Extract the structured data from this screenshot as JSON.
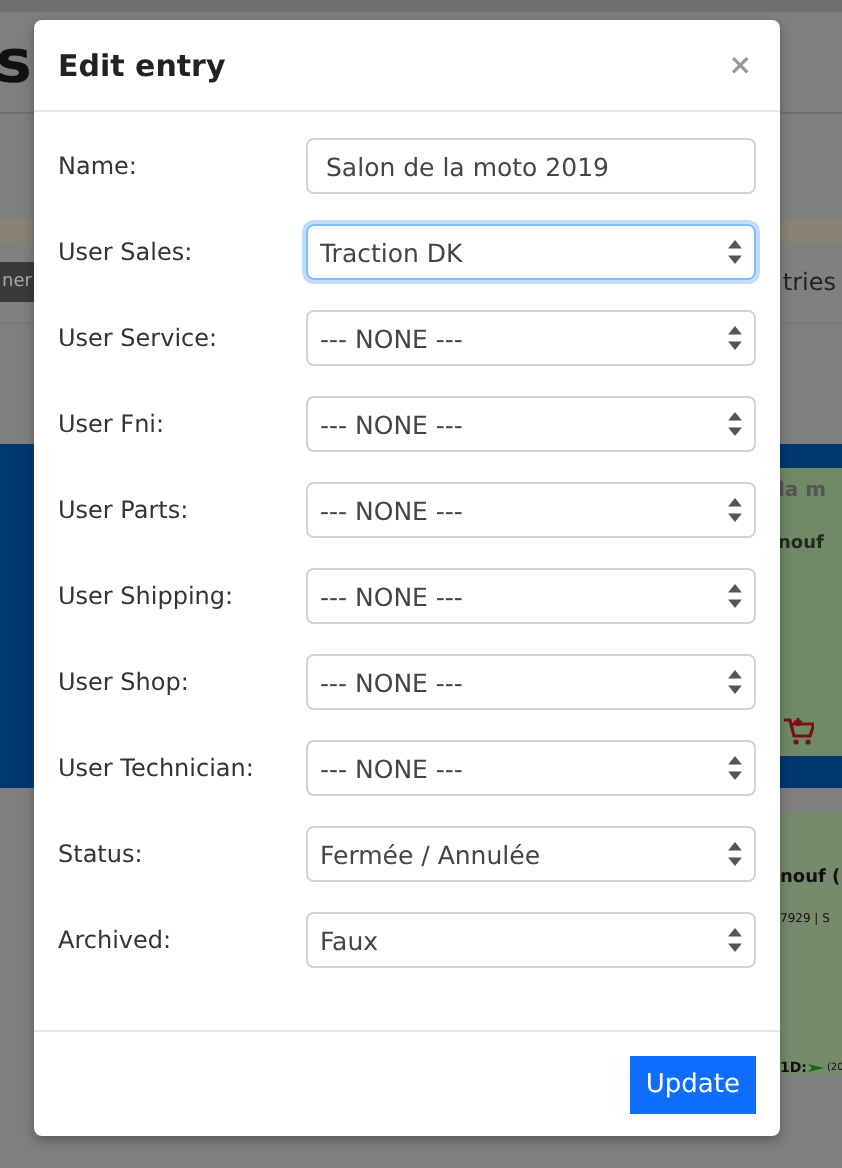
{
  "page": {
    "heading": "s",
    "toolbar_button": "ner",
    "toolbar_text": "tries",
    "card_1": {
      "title": "la m",
      "subtitle": "nouf"
    },
    "card_2": {
      "title": "nouf (",
      "meta": "7929 | S",
      "id_label": "1D:",
      "count": "(20"
    }
  },
  "modal": {
    "title": "Edit entry",
    "close": "×",
    "fields": [
      {
        "kind": "text",
        "label": "Name:",
        "value": "Salon de la moto 2019",
        "focused": false
      },
      {
        "kind": "select",
        "label": "User Sales:",
        "value": "Traction DK",
        "focused": true
      },
      {
        "kind": "select",
        "label": "User Service:",
        "value": "--- NONE ---",
        "focused": false
      },
      {
        "kind": "select",
        "label": "User Fni:",
        "value": "--- NONE ---",
        "focused": false
      },
      {
        "kind": "select",
        "label": "User Parts:",
        "value": "--- NONE ---",
        "focused": false
      },
      {
        "kind": "select",
        "label": "User Shipping:",
        "value": "--- NONE ---",
        "focused": false
      },
      {
        "kind": "select",
        "label": "User Shop:",
        "value": "--- NONE ---",
        "focused": false
      },
      {
        "kind": "select",
        "label": "User Technician:",
        "value": "--- NONE ---",
        "focused": false
      },
      {
        "kind": "select",
        "label": "Status:",
        "value": "Fermée / Annulée",
        "focused": false
      },
      {
        "kind": "select",
        "label": "Archived:",
        "value": "Faux",
        "focused": false
      }
    ],
    "submit": "Update"
  }
}
